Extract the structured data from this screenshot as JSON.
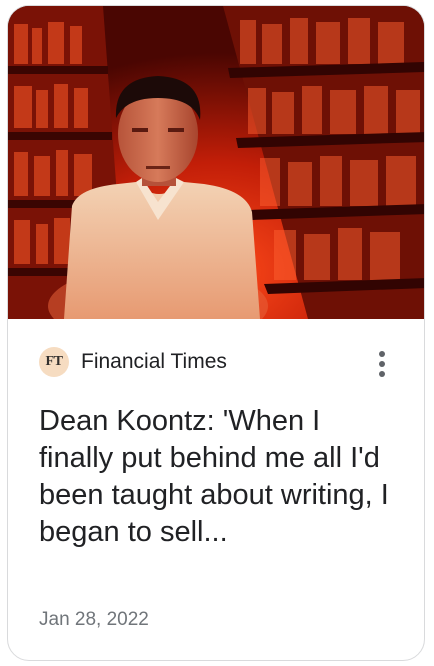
{
  "article": {
    "source": "Financial Times",
    "source_logo_text": "FT",
    "headline": "Dean Koontz: 'When I finally put behind me all I'd been taught about writing, I began to sell...",
    "date": "Jan 28, 2022",
    "image_icon": "author-portrait-photo",
    "menu_icon": "more-vert-icon"
  }
}
